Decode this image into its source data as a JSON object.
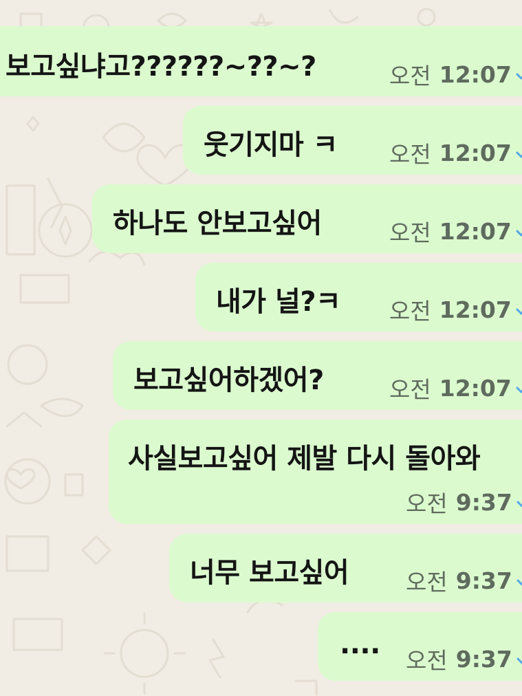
{
  "chat": {
    "messages": [
      {
        "text": "보고싶냐고??????~??~?",
        "ampm": "오전",
        "time": "12:07",
        "status": "read"
      },
      {
        "text": "웃기지마 ㅋ",
        "ampm": "오전",
        "time": "12:07",
        "status": "read"
      },
      {
        "text": "하나도 안보고싶어",
        "ampm": "오전",
        "time": "12:07",
        "status": "read"
      },
      {
        "text": "내가 널?ㅋ",
        "ampm": "오전",
        "time": "12:07",
        "status": "read"
      },
      {
        "text": "보고싶어하겠어?",
        "ampm": "오전",
        "time": "12:07",
        "status": "read"
      },
      {
        "text": "사실보고싶어 제발 다시 돌아와",
        "ampm": "오전",
        "time": "9:37",
        "status": "read"
      },
      {
        "text": "너무 보고싶어",
        "ampm": "오전",
        "time": "9:37",
        "status": "read"
      },
      {
        "text": "....",
        "ampm": "오전",
        "time": "9:37",
        "status": "read"
      }
    ]
  },
  "colors": {
    "outgoing_bubble": "#dbfbcf",
    "wallpaper": "#f1ece4",
    "read_tick": "#53a6e8"
  },
  "icons": {
    "status_icon": "double-check-icon"
  }
}
